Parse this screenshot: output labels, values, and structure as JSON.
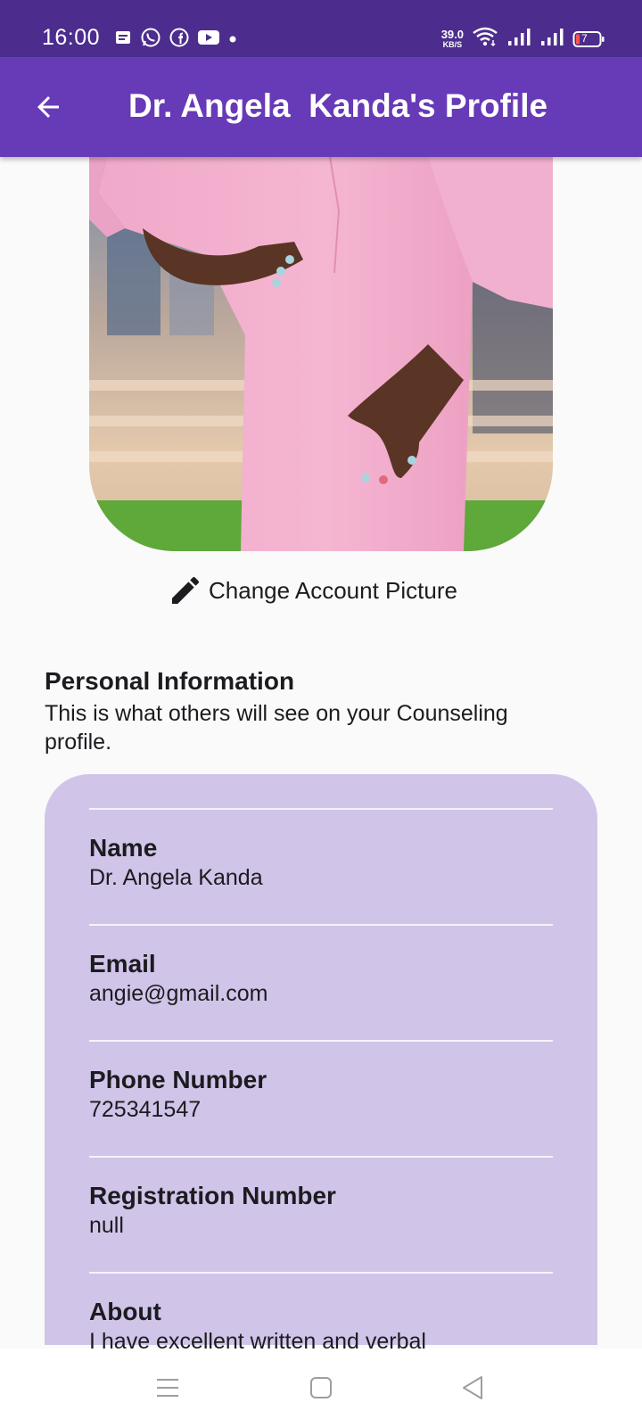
{
  "status_bar": {
    "time": "16:00",
    "net_speed_value": "39.0",
    "net_speed_unit": "KB/S",
    "battery": "7",
    "notification_icons": [
      "message-icon",
      "whatsapp-icon",
      "facebook-icon",
      "youtube-icon",
      "dot-icon"
    ],
    "system_icons": [
      "wifi-icon",
      "signal-icon",
      "signal-icon",
      "battery-icon"
    ]
  },
  "app_bar": {
    "title": "Dr. Angela  Kanda's Profile",
    "back_icon": "arrow-back-icon",
    "background": "#673ab7"
  },
  "profile": {
    "change_picture_label": "Change Account Picture",
    "change_picture_icon": "pencil-icon"
  },
  "personal_info": {
    "title": "Personal Information",
    "subtitle": "This is what others will see on your Counseling profile.",
    "card_color": "#d1c4e9",
    "fields": [
      {
        "label": "Name",
        "value": "Dr. Angela Kanda"
      },
      {
        "label": "Email",
        "value": "angie@gmail.com"
      },
      {
        "label": "Phone Number",
        "value": "725341547"
      },
      {
        "label": "Registration Number",
        "value": "null"
      },
      {
        "label": "About",
        "value": "I have excellent written and verbal"
      }
    ]
  },
  "nav_bar": {
    "buttons": [
      "menu-icon",
      "home-square-icon",
      "back-triangle-icon"
    ]
  }
}
